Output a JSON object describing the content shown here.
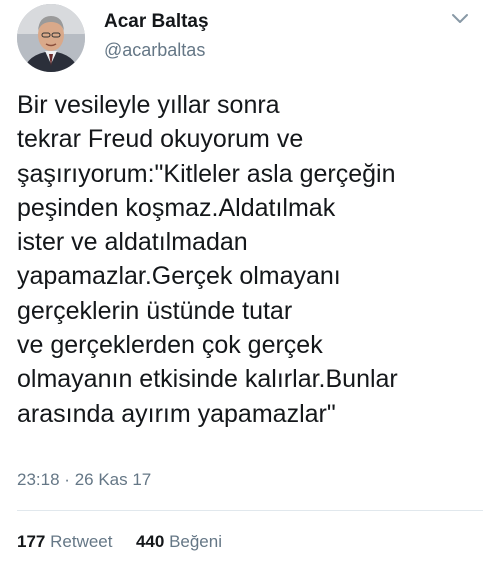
{
  "author": {
    "name": "Acar Baltaş",
    "handle": "@acarbaltas"
  },
  "tweet": {
    "lines": [
      "Bir vesileyle yıllar sonra",
      "tekrar Freud okuyorum ve",
      "şaşırıyorum:\"Kitleler asla gerçeğin",
      "peşinden koşmaz.Aldatılmak",
      "ister ve aldatılmadan",
      "yapamazlar.Gerçek olmayanı",
      "gerçeklerin üstünde tutar",
      "ve gerçeklerden çok gerçek",
      "olmayanın etkisinde kalırlar.Bunlar",
      "arasında ayırım yapamazlar\""
    ],
    "time": "23:18",
    "separator": "·",
    "date": "26 Kas 17"
  },
  "stats": {
    "retweet_count": "177",
    "retweet_label": "Retweet",
    "like_count": "440",
    "like_label": "Beğeni"
  },
  "icons": {
    "caret": "chevron-down-icon"
  },
  "colors": {
    "text": "#14171a",
    "secondary": "#657786",
    "divider": "#e1e8ed"
  }
}
